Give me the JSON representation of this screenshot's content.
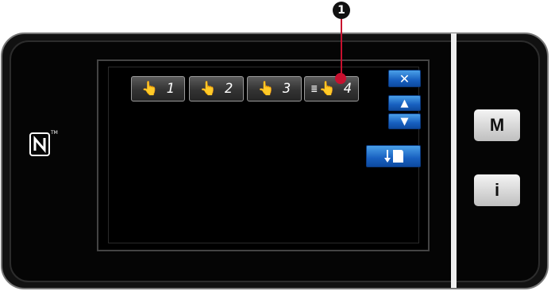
{
  "callout": {
    "number": "1"
  },
  "brand": {
    "nfc_icon": "nfc-icon",
    "trademark": "TM"
  },
  "mode_buttons": [
    {
      "hand": "👆",
      "label": "1"
    },
    {
      "hand": "👆",
      "label": "2"
    },
    {
      "hand": "👆",
      "label": "3"
    },
    {
      "lines": "≣",
      "hand": "👆",
      "label": "4"
    }
  ],
  "controls": {
    "close": "✕",
    "up": "▲",
    "down": "▼",
    "thread_icon": "thread-down-icon"
  },
  "side_buttons": {
    "mode": "M",
    "info": "i"
  },
  "colors": {
    "accent_blue": "#1860c0",
    "callout_red": "#c8102e"
  }
}
